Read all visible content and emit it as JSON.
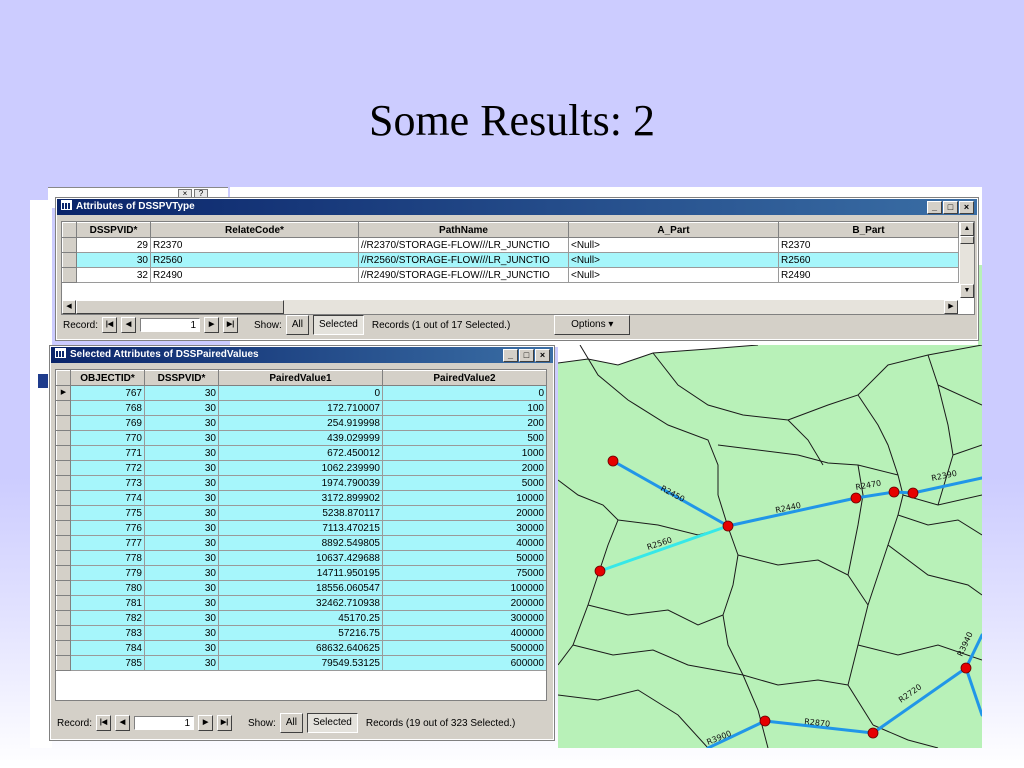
{
  "slide": {
    "title": "Some Results:  2"
  },
  "attr_window": {
    "title": "Attributes of DSSPVType",
    "columns": [
      "DSSPVID*",
      "RelateCode*",
      "PathName",
      "A_Part",
      "B_Part"
    ],
    "rows": [
      [
        "29",
        "R2370",
        "//R2370/STORAGE-FLOW///LR_JUNCTIO",
        "<Null>",
        "R2370"
      ],
      [
        "30",
        "R2560",
        "//R2560/STORAGE-FLOW///LR_JUNCTIO",
        "<Null>",
        "R2560"
      ],
      [
        "32",
        "R2490",
        "//R2490/STORAGE-FLOW///LR_JUNCTIO",
        "<Null>",
        "R2490"
      ]
    ],
    "highlighted_row": 1,
    "status": {
      "record_label": "Record:",
      "record_value": "1",
      "show_label": "Show:",
      "all_label": "All",
      "selected_label": "Selected",
      "records_text": "Records  (1 out of 17 Selected.)",
      "options_label": "Options"
    }
  },
  "sel_window": {
    "title": "Selected Attributes of DSSPairedValues",
    "columns": [
      "OBJECTID*",
      "DSSPVID*",
      "PairedValue1",
      "PairedValue2"
    ],
    "rows": [
      [
        "767",
        "30",
        "0",
        "0"
      ],
      [
        "768",
        "30",
        "172.710007",
        "100"
      ],
      [
        "769",
        "30",
        "254.919998",
        "200"
      ],
      [
        "770",
        "30",
        "439.029999",
        "500"
      ],
      [
        "771",
        "30",
        "672.450012",
        "1000"
      ],
      [
        "772",
        "30",
        "1062.239990",
        "2000"
      ],
      [
        "773",
        "30",
        "1974.790039",
        "5000"
      ],
      [
        "774",
        "30",
        "3172.899902",
        "10000"
      ],
      [
        "775",
        "30",
        "5238.870117",
        "20000"
      ],
      [
        "776",
        "30",
        "7113.470215",
        "30000"
      ],
      [
        "777",
        "30",
        "8892.549805",
        "40000"
      ],
      [
        "778",
        "30",
        "10637.429688",
        "50000"
      ],
      [
        "779",
        "30",
        "14711.950195",
        "75000"
      ],
      [
        "780",
        "30",
        "18556.060547",
        "100000"
      ],
      [
        "781",
        "30",
        "32462.710938",
        "200000"
      ],
      [
        "782",
        "30",
        "45170.25",
        "300000"
      ],
      [
        "783",
        "30",
        "57216.75",
        "400000"
      ],
      [
        "784",
        "30",
        "68632.640625",
        "500000"
      ],
      [
        "785",
        "30",
        "79549.53125",
        "600000"
      ]
    ],
    "status": {
      "record_label": "Record:",
      "record_value": "1",
      "show_label": "Show:",
      "all_label": "All",
      "selected_label": "Selected",
      "records_text": "Records  (19 out of 323 Selected.)"
    }
  },
  "map": {
    "reach_labels": [
      "R2450",
      "R2440",
      "R2470",
      "R2390",
      "R2560",
      "R3940",
      "R2720",
      "R2870",
      "R3900"
    ],
    "colors": {
      "watershed": "#b8f1b8",
      "reach": "#2196e8",
      "selected_reach": "#36e8e8",
      "node": "#e60000"
    }
  }
}
